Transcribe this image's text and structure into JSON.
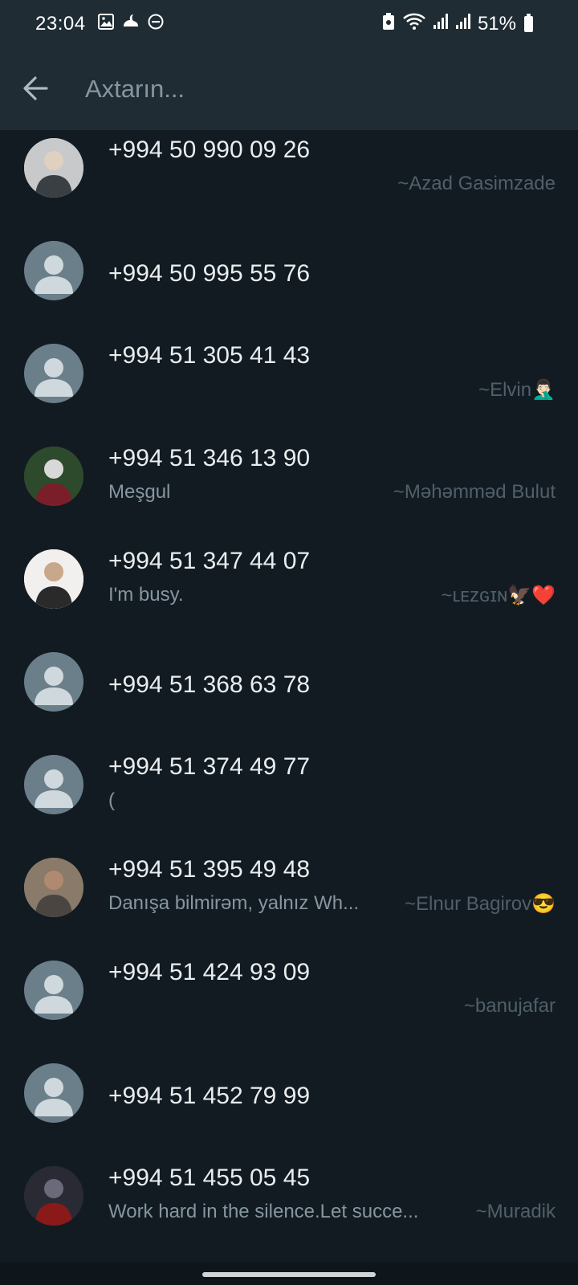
{
  "status_bar": {
    "time": "23:04",
    "left_icons": [
      "gallery-icon",
      "sleep-mode-icon",
      "do-not-disturb-icon"
    ],
    "right_icons": [
      "battery-saver-icon",
      "wifi-icon",
      "signal-icon-1",
      "signal-icon-2"
    ],
    "battery": "51%"
  },
  "search": {
    "placeholder": "Axtarın...",
    "back_icon": "arrow-left-icon"
  },
  "contacts": [
    {
      "phone": "+994 50 990 09 26",
      "about": "",
      "pushname": "~Azad Gasimzade",
      "avatar": "photo"
    },
    {
      "phone": "+994 50 995 55 76",
      "about": "",
      "pushname": "",
      "avatar": "default"
    },
    {
      "phone": "+994 51 305 41 43",
      "about": "",
      "pushname": "~Elvin🤦🏻‍♂️",
      "avatar": "default"
    },
    {
      "phone": "+994 51 346 13 90",
      "about": "Meşgul",
      "pushname": "~Məhəmməd Bulut",
      "avatar": "photo"
    },
    {
      "phone": "+994 51 347 44 07",
      "about": "I'm busy.",
      "pushname": "~ʟᴇᴢɢɪɴ🦅❤️",
      "avatar": "photo"
    },
    {
      "phone": "+994 51 368 63 78",
      "about": "",
      "pushname": "",
      "avatar": "default"
    },
    {
      "phone": "+994 51 374 49 77",
      "about": "(",
      "pushname": "",
      "avatar": "default"
    },
    {
      "phone": "+994 51 395 49 48",
      "about": "Danışa bilmirəm, yalnız Wh...",
      "pushname": "~Elnur Bagirov😎",
      "avatar": "photo"
    },
    {
      "phone": "+994 51 424 93 09",
      "about": "",
      "pushname": "~banujafar",
      "avatar": "default"
    },
    {
      "phone": "+994 51 452 79 99",
      "about": "",
      "pushname": "",
      "avatar": "default"
    },
    {
      "phone": "+994 51 455 05 45",
      "about": "Work hard in the silence.Let succe...",
      "pushname": "~Muradik",
      "avatar": "photo"
    }
  ],
  "colors": {
    "header_bg": "#1f2c34",
    "list_bg": "#121b22",
    "primary_text": "#e9edef",
    "secondary_text": "#8696a0",
    "pushname_text": "#505f69",
    "default_avatar_bg": "#6a7f8a"
  }
}
